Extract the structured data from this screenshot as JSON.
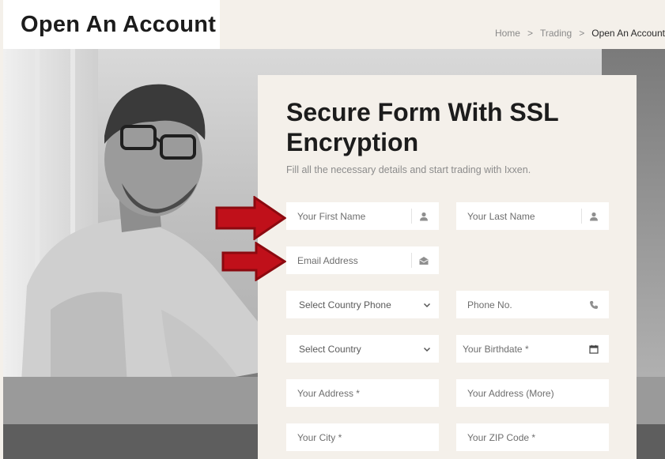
{
  "header": {
    "title": "Open An Account",
    "breadcrumb": {
      "home": "Home",
      "sep": ">",
      "trading": "Trading",
      "current": "Open An Account"
    }
  },
  "form": {
    "title": "Secure Form With SSL Encryption",
    "subtitle": "Fill all the necessary details and start trading with Ixxen.",
    "first_name": {
      "placeholder": "Your First Name",
      "icon": "user-icon"
    },
    "last_name": {
      "placeholder": "Your Last Name",
      "icon": "user-icon"
    },
    "email": {
      "placeholder": "Email Address",
      "icon": "envelope-icon"
    },
    "country_phone": {
      "selected": "Select Country Phone",
      "icon": "chevron-down-icon"
    },
    "phone": {
      "placeholder": "Phone No.",
      "icon": "phone-icon"
    },
    "country": {
      "selected": "Select Country",
      "icon": "chevron-down-icon"
    },
    "birthdate": {
      "placeholder": "Your Birthdate *",
      "icon": "calendar-icon"
    },
    "address": {
      "placeholder": "Your Address *"
    },
    "address_more": {
      "placeholder": "Your Address (More)"
    },
    "city": {
      "placeholder": "Your City *"
    },
    "zip": {
      "placeholder": "Your ZIP Code *"
    }
  },
  "colors": {
    "page_bg": "#f4f0ea",
    "card_bg": "#f4f0ea",
    "arrow_red": "#c0101a",
    "arrow_dark": "#8c0a10"
  }
}
